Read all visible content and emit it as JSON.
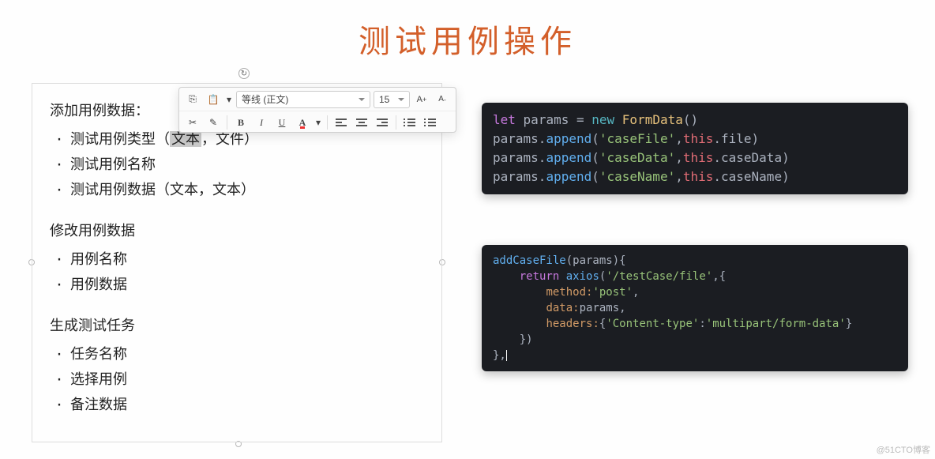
{
  "title": "测试用例操作",
  "toolbar": {
    "font_name": "等线 (正文)",
    "font_size": "15"
  },
  "sections": {
    "s1": {
      "heading": "添加用例数据：",
      "items": {
        "i0_pre": "测试用例类型（",
        "i0_hl": "文本",
        "i0_post": "，文件）",
        "i1": "测试用例名称",
        "i2": "测试用例数据（文本，文本）"
      }
    },
    "s2": {
      "heading": "修改用例数据",
      "items": {
        "i0": "用例名称",
        "i1": "用例数据"
      }
    },
    "s3": {
      "heading": "生成测试任务",
      "items": {
        "i0": "任务名称",
        "i1": "选择用例",
        "i2": "备注数据"
      }
    }
  },
  "code1": {
    "l1_let": "let",
    "l1_params": "params",
    "l1_eq": " = ",
    "l1_new": "new",
    "l1_fd": "FormData",
    "l1_p": "()",
    "l2_a": "params.",
    "l2_fn": "append",
    "l2_p": "(",
    "l2_s": "'caseFile'",
    "l2_c": ",",
    "l2_t": "this",
    "l2_d": ".file)",
    "l3_s": "'caseData'",
    "l3_d": ".caseData)",
    "l4_s": "'caseName'",
    "l4_d": ".caseName)"
  },
  "code2": {
    "l1_fn": "addCaseFile",
    "l1_p": "(params){",
    "l2_ret": "return",
    "l2_ax": "axios",
    "l2_p1": "(",
    "l2_url": "'/testCase/file'",
    "l2_p2": ",{",
    "l3_k": "method:",
    "l3_v": "'post'",
    "l3_c": ",",
    "l4_k": "data:",
    "l4_v": "params,",
    "l5_k": "headers:",
    "l5_p1": "{",
    "l5_hk": "'Content-type'",
    "l5_col": ":",
    "l5_hv": "'multipart/form-data'",
    "l5_p2": "}",
    "l6": "})",
    "l7": "},"
  },
  "watermark": "@51CTO博客"
}
